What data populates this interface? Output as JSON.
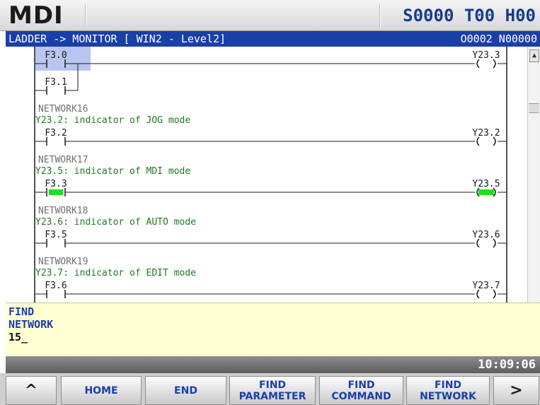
{
  "header": {
    "mode": "MDI",
    "status": "S0000 T00 H00"
  },
  "titlebar": {
    "path": "LADDER -> MONITOR [ WIN2 - Level2]",
    "program": "O0002 N00000"
  },
  "ladder": {
    "rungs": [
      {
        "network": "",
        "comment": "",
        "contacts": [
          {
            "label": "F3.0",
            "state": "selected"
          },
          {
            "label": "F3.1",
            "state": "off"
          }
        ],
        "coil": {
          "label": "Y23.3",
          "state": "off"
        }
      },
      {
        "network": "NETWORK16",
        "comment": "Y23.2: indicator of JOG mode",
        "contacts": [
          {
            "label": "F3.2",
            "state": "off"
          }
        ],
        "coil": {
          "label": "Y23.2",
          "state": "off"
        }
      },
      {
        "network": "NETWORK17",
        "comment": "Y23.5: indicator of MDI mode",
        "contacts": [
          {
            "label": "F3.3",
            "state": "on"
          }
        ],
        "coil": {
          "label": "Y23.5",
          "state": "on"
        }
      },
      {
        "network": "NETWORK18",
        "comment": "Y23.6: indicator of AUTO mode",
        "contacts": [
          {
            "label": "F3.5",
            "state": "off"
          }
        ],
        "coil": {
          "label": "Y23.6",
          "state": "off"
        }
      },
      {
        "network": "NETWORK19",
        "comment": "Y23.7: indicator of EDIT mode",
        "contacts": [
          {
            "label": "F3.6",
            "state": "off"
          }
        ],
        "coil": {
          "label": "Y23.7",
          "state": "off"
        }
      }
    ],
    "colors": {
      "rail": "#1a1a1a",
      "network": "#707070",
      "comment": "#1f7a1f",
      "label": "#1a1a1a",
      "energized": "#22dd22",
      "selection": "#b9c6f0"
    }
  },
  "find": {
    "line1": "FIND",
    "line2": "NETWORK",
    "input": "15_"
  },
  "clock": "10:09:06",
  "softkeys": [
    {
      "name": "softkey-prev",
      "lines": [
        "^"
      ],
      "arrow": true
    },
    {
      "name": "softkey-home",
      "lines": [
        "HOME"
      ]
    },
    {
      "name": "softkey-end",
      "lines": [
        "END"
      ]
    },
    {
      "name": "softkey-find-parameter",
      "lines": [
        "FIND",
        "PARAMETER"
      ]
    },
    {
      "name": "softkey-find-command",
      "lines": [
        "FIND",
        "COMMAND"
      ]
    },
    {
      "name": "softkey-find-network",
      "lines": [
        "FIND",
        "NETWORK"
      ]
    },
    {
      "name": "softkey-next",
      "lines": [
        ">"
      ],
      "arrow": true
    }
  ]
}
